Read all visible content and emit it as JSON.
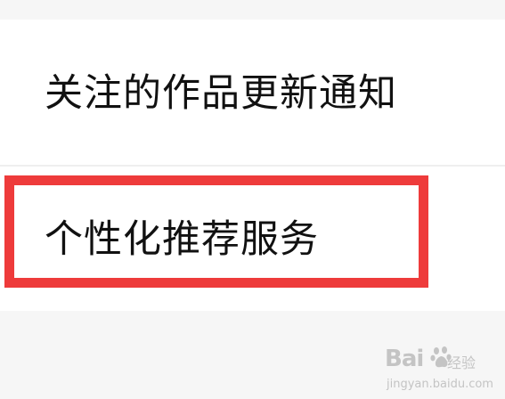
{
  "settings_list": {
    "items": [
      {
        "label": "关注的作品更新通知"
      },
      {
        "label": "个性化推荐服务"
      }
    ]
  },
  "highlight": {
    "color": "#ee3b3b",
    "target": "个性化推荐服务"
  },
  "watermark": {
    "logo_text": "Bai",
    "logo_tail": "经验",
    "url": "jingyan.baidu.com"
  },
  "colors": {
    "background": "#f6f6f6",
    "row_background": "#ffffff",
    "text": "#111111"
  }
}
